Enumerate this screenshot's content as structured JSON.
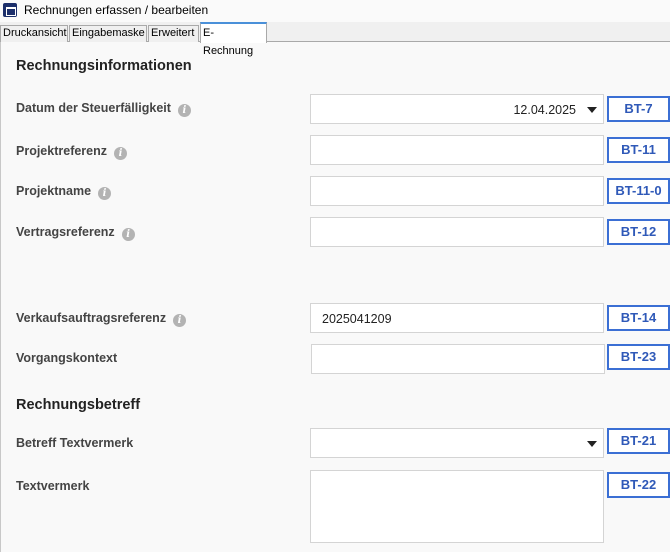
{
  "window": {
    "title": "Rechnungen erfassen / bearbeiten",
    "icon": "app-icon"
  },
  "tabs": [
    {
      "label": "Druckansicht"
    },
    {
      "label": "Eingabemaske"
    },
    {
      "label": "Erweitert"
    },
    {
      "label": "E-Rechnung",
      "active": true
    }
  ],
  "sections": {
    "invoice_info": "Rechnungsinformationen",
    "invoice_subject": "Rechnungsbetreff"
  },
  "fields": {
    "tax_due_date": {
      "label": "Datum der Steuerfälligkeit",
      "value": "12.04.2025",
      "code": "BT-7"
    },
    "project_reference": {
      "label": "Projektreferenz",
      "value": "",
      "code": "BT-11"
    },
    "project_name": {
      "label": "Projektname",
      "value": "",
      "code": "BT-11-0"
    },
    "contract_reference": {
      "label": "Vertragsreferenz",
      "value": "",
      "code": "BT-12"
    },
    "sales_order_reference": {
      "label": "Verkaufsauftragsreferenz",
      "value": "2025041209",
      "code": "BT-14"
    },
    "process_context": {
      "label": "Vorgangskontext",
      "value": "",
      "code": "BT-23"
    },
    "subject_note": {
      "label": "Betreff Textvermerk",
      "value": "",
      "code": "BT-21"
    },
    "note": {
      "label": "Textvermerk",
      "value": "",
      "code": "BT-22"
    }
  },
  "icons": {
    "info": "i"
  },
  "colors": {
    "accent": "#3b6fd4",
    "code_text": "#2f59b8",
    "active_tab": "#4a90d9"
  }
}
